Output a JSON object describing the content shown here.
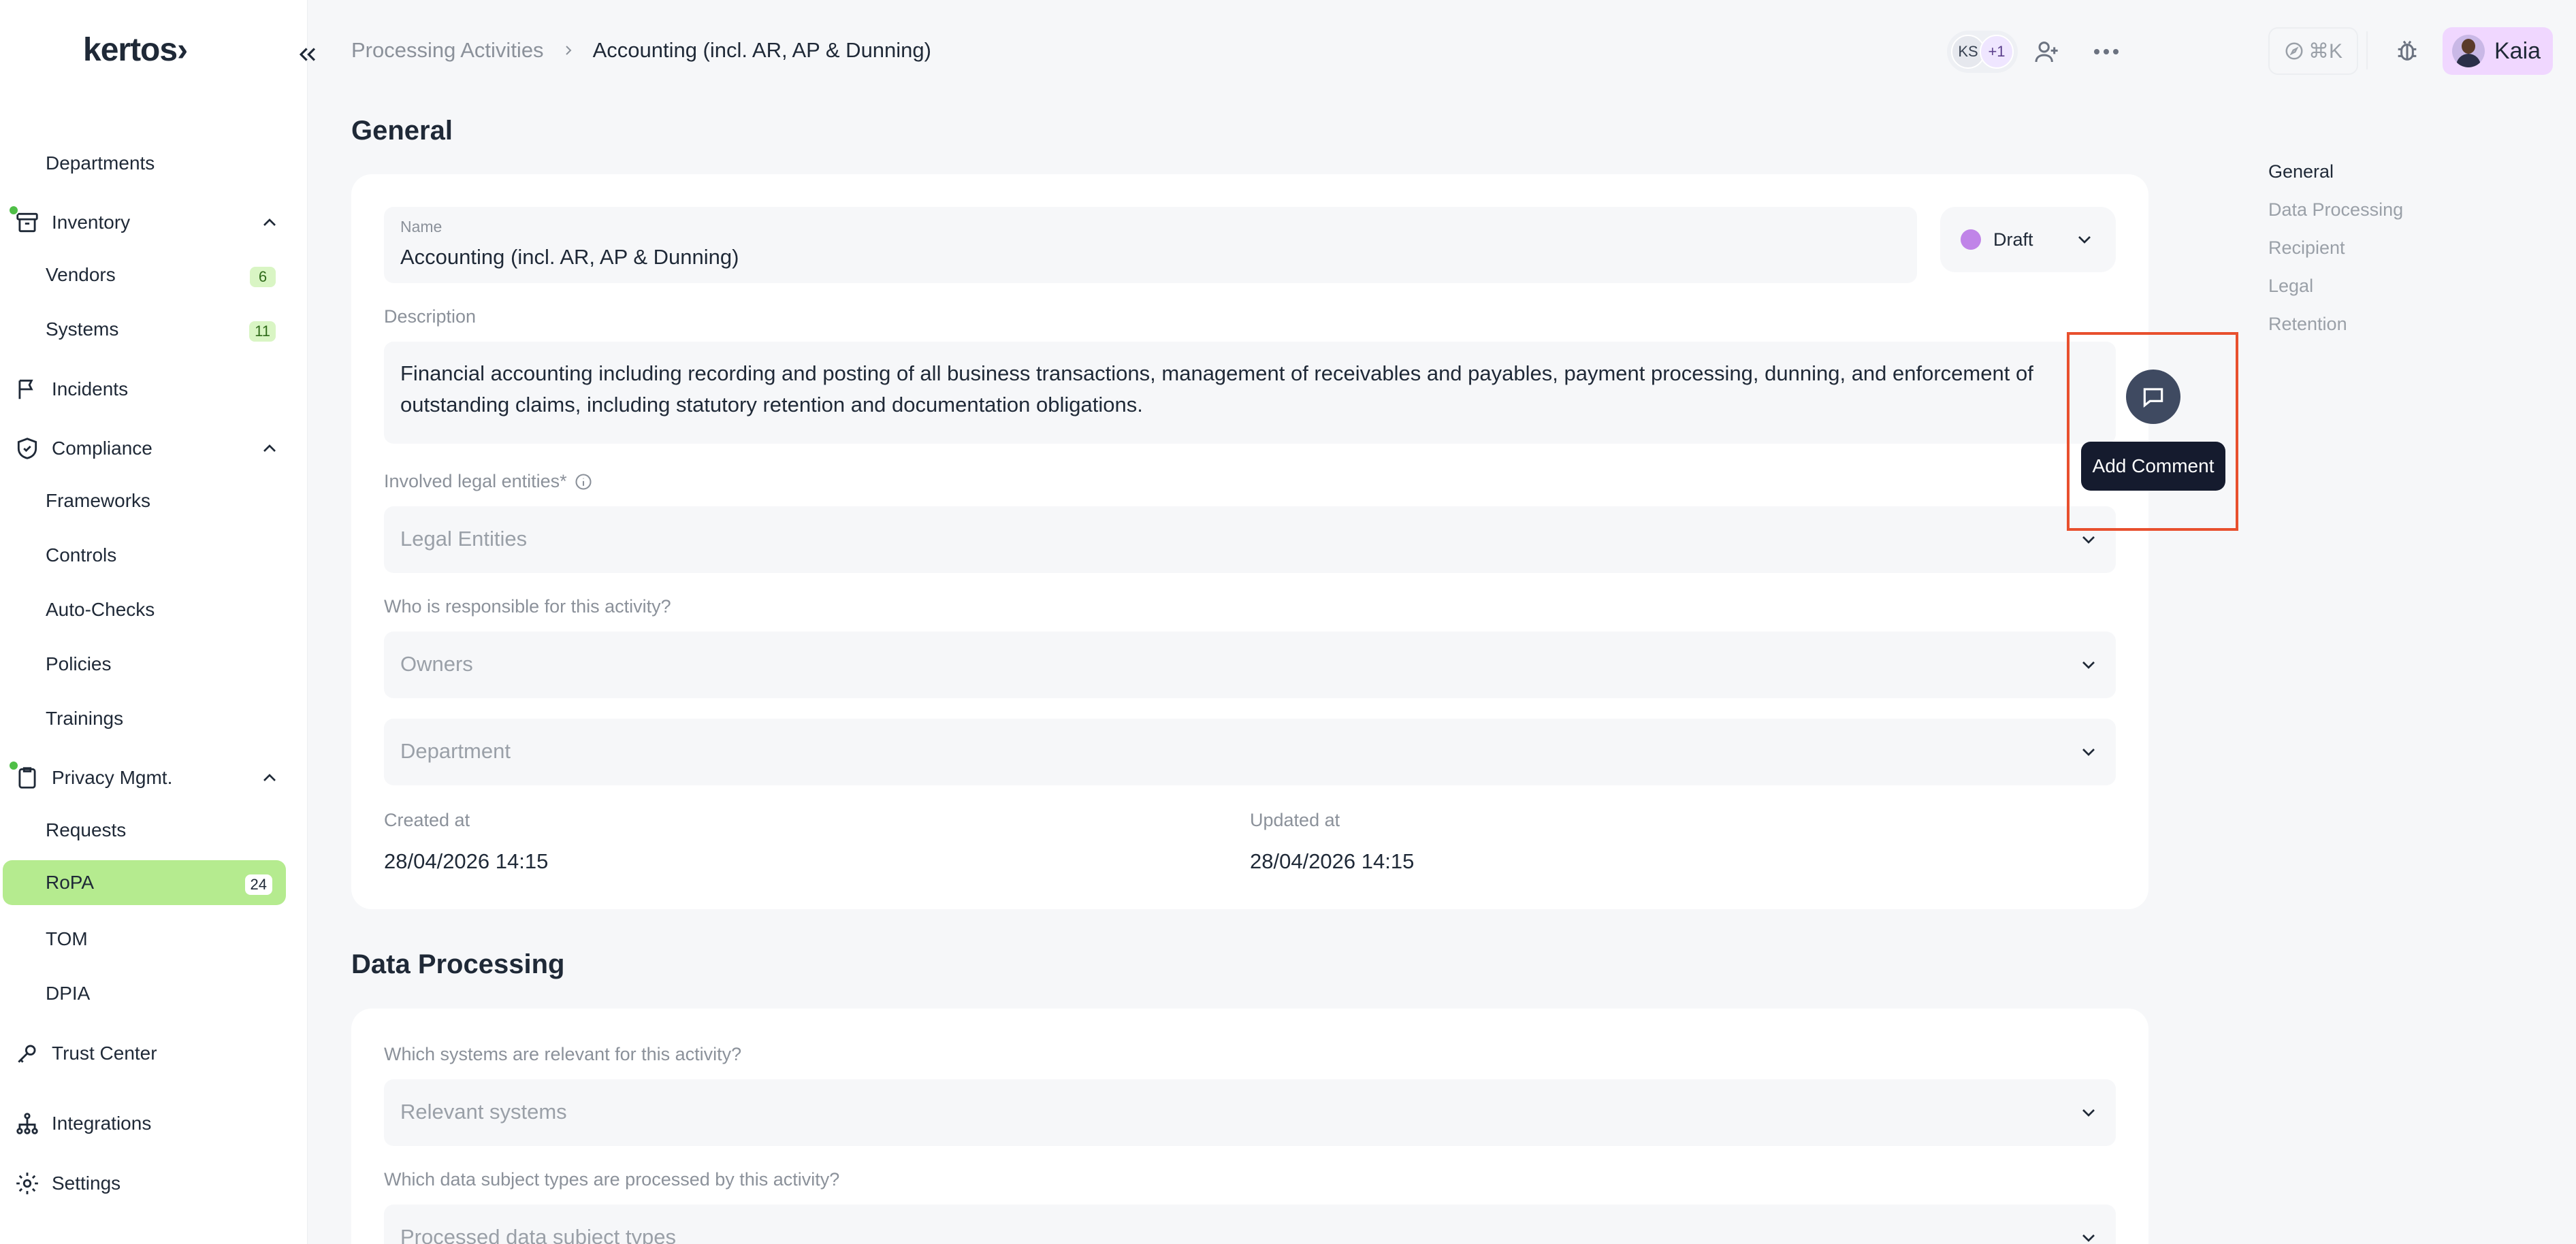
{
  "app": {
    "logo": "kertos›"
  },
  "sidebar": {
    "items": [
      {
        "key": "departments",
        "label": "Departments"
      },
      {
        "key": "inventory",
        "label": "Inventory"
      },
      {
        "key": "vendors",
        "label": "Vendors",
        "badge": "6"
      },
      {
        "key": "systems",
        "label": "Systems",
        "badge": "11"
      },
      {
        "key": "incidents",
        "label": "Incidents"
      },
      {
        "key": "compliance",
        "label": "Compliance"
      },
      {
        "key": "frameworks",
        "label": "Frameworks"
      },
      {
        "key": "controls",
        "label": "Controls"
      },
      {
        "key": "auto-checks",
        "label": "Auto-Checks"
      },
      {
        "key": "policies",
        "label": "Policies"
      },
      {
        "key": "trainings",
        "label": "Trainings"
      },
      {
        "key": "privacy",
        "label": "Privacy Mgmt."
      },
      {
        "key": "requests",
        "label": "Requests"
      },
      {
        "key": "ropa",
        "label": "RoPA",
        "badge": "24"
      },
      {
        "key": "tom",
        "label": "TOM"
      },
      {
        "key": "dpia",
        "label": "DPIA"
      },
      {
        "key": "trust-center",
        "label": "Trust Center"
      },
      {
        "key": "integrations",
        "label": "Integrations"
      },
      {
        "key": "settings",
        "label": "Settings"
      }
    ]
  },
  "header": {
    "breadcrumb_parent": "Processing Activities",
    "breadcrumb_current": "Accounting (incl. AR, AP & Dunning)",
    "collaborators": {
      "initials": "KS",
      "more": "+1"
    },
    "shortcut": "⌘K",
    "user_name": "Kaia"
  },
  "toc": [
    "General",
    "Data Processing",
    "Recipient",
    "Legal",
    "Retention"
  ],
  "general": {
    "title": "General",
    "name_label": "Name",
    "name_value": "Accounting (incl. AR, AP & Dunning)",
    "status": "Draft",
    "description_label": "Description",
    "description_value": "Financial accounting including recording and posting of all business transactions, management of receivables and payables, payment processing, dunning, and enforcement of outstanding claims, including statutory retention and documentation obligations.",
    "legal_entities_label": "Involved legal entities*",
    "legal_entities_placeholder": "Legal Entities",
    "responsible_label": "Who is responsible for this activity?",
    "owners_placeholder": "Owners",
    "department_placeholder": "Department",
    "created_label": "Created at",
    "created_value": "28/04/2026 14:15",
    "updated_label": "Updated at",
    "updated_value": "28/04/2026 14:15"
  },
  "comment": {
    "tooltip": "Add Comment"
  },
  "data_processing": {
    "title": "Data Processing",
    "systems_label": "Which systems are relevant for this activity?",
    "systems_placeholder": "Relevant systems",
    "subjects_label": "Which data subject types are processed by this activity?",
    "subjects_placeholder": "Processed data subject types"
  },
  "colors": {
    "accent": "#b5eb8f",
    "status_draft": "#c084e8",
    "highlight": "#e8502e"
  }
}
